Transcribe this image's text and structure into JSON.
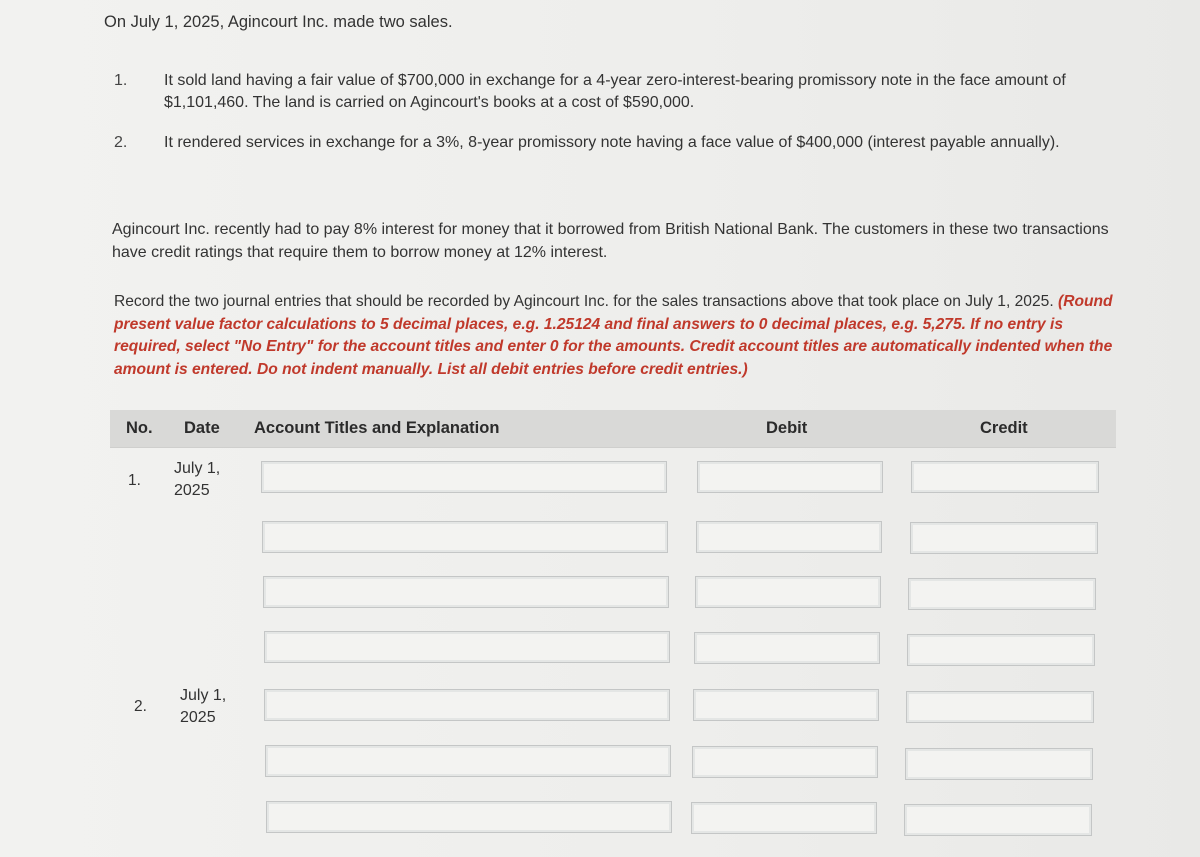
{
  "intro": "On July 1, 2025, Agincourt Inc. made two sales.",
  "transactions": [
    {
      "number": "1.",
      "text": "It sold land having a fair value of $700,000 in exchange for a 4-year zero-interest-bearing promissory note in the face amount of $1,101,460. The land is carried on Agincourt's books at a cost of $590,000."
    },
    {
      "number": "2.",
      "text": "It rendered services in exchange for a 3%, 8-year promissory note having a face value of $400,000 (interest payable annually)."
    }
  ],
  "context": "Agincourt Inc. recently had to pay 8% interest for money that it borrowed from British National Bank. The customers in these two transactions have credit ratings that require them to borrow money at 12% interest.",
  "instructions": {
    "lead": "Record the two journal entries that should be recorded by Agincourt Inc. for the sales transactions above that took place on July 1, 2025.",
    "note": "(Round present value factor calculations to 5 decimal places, e.g. 1.25124 and final answers to 0 decimal places, e.g. 5,275. If no entry is required, select \"No Entry\" for the account titles and enter 0 for the amounts. Credit account titles are automatically indented when the amount is entered. Do not indent manually. List all debit entries before credit entries.)"
  },
  "table": {
    "headers": {
      "no": "No.",
      "date": "Date",
      "account": "Account Titles and Explanation",
      "debit": "Debit",
      "credit": "Credit"
    },
    "entries": [
      {
        "no": "1.",
        "date_line1": "July 1,",
        "date_line2": "2025",
        "rows": [
          {
            "account": "",
            "debit": "",
            "credit": ""
          },
          {
            "account": "",
            "debit": "",
            "credit": ""
          },
          {
            "account": "",
            "debit": "",
            "credit": ""
          },
          {
            "account": "",
            "debit": "",
            "credit": ""
          }
        ]
      },
      {
        "no": "2.",
        "date_line1": "July 1,",
        "date_line2": "2025",
        "rows": [
          {
            "account": "",
            "debit": "",
            "credit": ""
          },
          {
            "account": "",
            "debit": "",
            "credit": ""
          },
          {
            "account": "",
            "debit": "",
            "credit": ""
          }
        ]
      }
    ]
  }
}
